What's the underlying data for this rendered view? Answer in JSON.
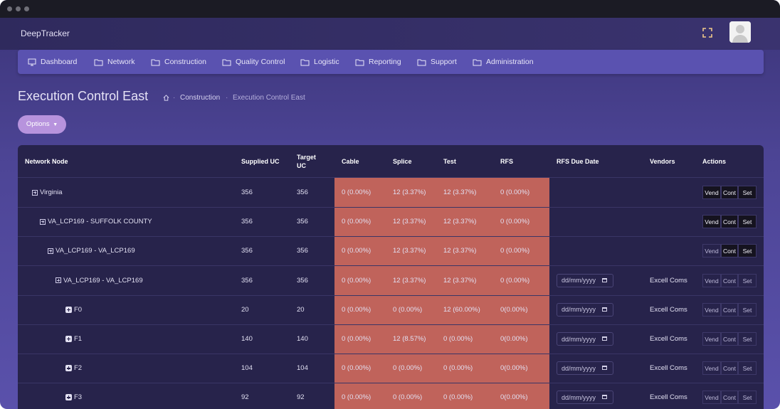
{
  "app": {
    "brand": "DeepTracker"
  },
  "nav": [
    {
      "label": "Dashboard",
      "icon": "monitor-icon"
    },
    {
      "label": "Network",
      "icon": "folder-icon"
    },
    {
      "label": "Construction",
      "icon": "folder-icon"
    },
    {
      "label": "Quality Control",
      "icon": "folder-icon"
    },
    {
      "label": "Logistic",
      "icon": "folder-icon"
    },
    {
      "label": "Reporting",
      "icon": "folder-icon"
    },
    {
      "label": "Support",
      "icon": "folder-icon"
    },
    {
      "label": "Administration",
      "icon": "folder-icon"
    }
  ],
  "page": {
    "title": "Execution Control East",
    "breadcrumb": [
      "Construction",
      "Execution Control East"
    ],
    "options_label": "Options"
  },
  "table": {
    "headers": [
      "Network Node",
      "Supplied UC",
      "Target UC",
      "Cable",
      "Splice",
      "Test",
      "RFS",
      "RFS Due Date",
      "Vendors",
      "Actions"
    ],
    "date_placeholder": "dd/mm/yyyy",
    "actions": [
      "Vend",
      "Cont",
      "Set"
    ],
    "rows": [
      {
        "node": "Virginia",
        "level": 0,
        "supplied": "356",
        "target": "356",
        "cable": "0 (0.00%)",
        "splice": "12 (3.37%)",
        "test": "12 (3.37%)",
        "rfs": "0 (0.00%)",
        "date": false,
        "vendor": "",
        "btn_style": [
          "dark",
          "dark",
          "dark"
        ]
      },
      {
        "node": "VA_LCP169 - SUFFOLK COUNTY",
        "level": 1,
        "supplied": "356",
        "target": "356",
        "cable": "0 (0.00%)",
        "splice": "12 (3.37%)",
        "test": "12 (3.37%)",
        "rfs": "0 (0.00%)",
        "date": false,
        "vendor": "",
        "btn_style": [
          "dark",
          "dark",
          "dark"
        ]
      },
      {
        "node": "VA_LCP169 - VA_LCP169",
        "level": 2,
        "supplied": "356",
        "target": "356",
        "cable": "0 (0.00%)",
        "splice": "12 (3.37%)",
        "test": "12 (3.37%)",
        "rfs": "0 (0.00%)",
        "date": false,
        "vendor": "",
        "btn_style": [
          "light",
          "dark",
          "dark"
        ]
      },
      {
        "node": "VA_LCP169 - VA_LCP169",
        "level": 3,
        "supplied": "356",
        "target": "356",
        "cable": "0 (0.00%)",
        "splice": "12 (3.37%)",
        "test": "12 (3.37%)",
        "rfs": "0 (0.00%)",
        "date": true,
        "vendor": "Excell Coms",
        "btn_style": [
          "light",
          "light",
          "light"
        ]
      },
      {
        "node": "F0",
        "level": 4,
        "supplied": "20",
        "target": "20",
        "cable": "0 (0.00%)",
        "splice": "0 (0.00%)",
        "test": "12 (60.00%)",
        "rfs": "0(0.00%)",
        "date": true,
        "vendor": "Excell Coms",
        "btn_style": [
          "light",
          "light",
          "light"
        ]
      },
      {
        "node": "F1",
        "level": 4,
        "supplied": "140",
        "target": "140",
        "cable": "0 (0.00%)",
        "splice": "12 (8.57%)",
        "test": "0 (0.00%)",
        "rfs": "0(0.00%)",
        "date": true,
        "vendor": "Excell Coms",
        "btn_style": [
          "light",
          "light",
          "light"
        ]
      },
      {
        "node": "F2",
        "level": 4,
        "supplied": "104",
        "target": "104",
        "cable": "0 (0.00%)",
        "splice": "0 (0.00%)",
        "test": "0 (0.00%)",
        "rfs": "0(0.00%)",
        "date": true,
        "vendor": "Excell Coms",
        "btn_style": [
          "light",
          "light",
          "light"
        ]
      },
      {
        "node": "F3",
        "level": 4,
        "supplied": "92",
        "target": "92",
        "cable": "0 (0.00%)",
        "splice": "0 (0.00%)",
        "test": "0 (0.00%)",
        "rfs": "0(0.00%)",
        "date": true,
        "vendor": "Excell Coms",
        "btn_style": [
          "light",
          "light",
          "light"
        ]
      }
    ]
  }
}
